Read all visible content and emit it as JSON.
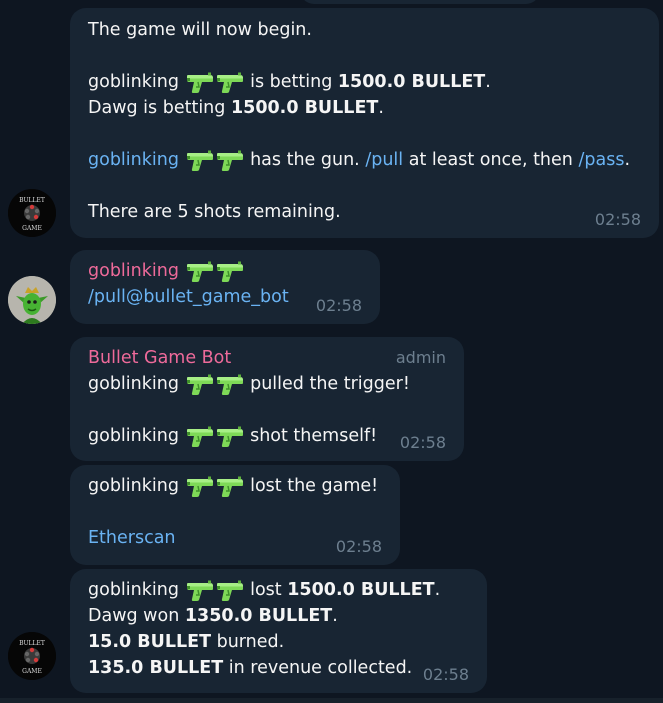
{
  "chat": {
    "m1": {
      "l1": "The game will now begin.",
      "l2_user": "goblinking",
      "l2_text": "is betting",
      "l2_amount": "1500.0 BULLET",
      "l2_end": ".",
      "l3_user": "Dawg is betting",
      "l3_amount": "1500.0 BULLET",
      "l3_end": ".",
      "l4_user": "goblinking",
      "l4_text1": "has the gun.",
      "l4_cmd1": "/pull",
      "l4_text2": "at least once, then",
      "l4_cmd2": "/pass",
      "l4_end": ".",
      "l5": "There are 5 shots remaining.",
      "time": "02:58"
    },
    "m2": {
      "sender": "goblinking",
      "command": "/pull@bullet_game_bot",
      "time": "02:58"
    },
    "m3": {
      "sender": "Bullet Game Bot",
      "role": "admin",
      "l1_user": "goblinking",
      "l1_text": "pulled the trigger!",
      "l2_user": "goblinking",
      "l2_text": "shot themself!",
      "time": "02:58"
    },
    "m4": {
      "l1_user": "goblinking",
      "l1_text": "lost the game!",
      "link": "Etherscan",
      "time": "02:58"
    },
    "m5": {
      "l1_user": "goblinking",
      "l1_text": "lost",
      "l1_amount": "1500.0 BULLET",
      "l1_end": ".",
      "l2_text": "Dawg won",
      "l2_amount": "1350.0 BULLET",
      "l2_end": ".",
      "l3_amount": "15.0 BULLET",
      "l3_text": "burned.",
      "l4_amount": "135.0 BULLET",
      "l4_text": "in revenue collected.",
      "time": "02:58"
    },
    "avatars": {
      "bot_logo_text_top": "BULLET",
      "bot_logo_text_bottom": "GAME"
    }
  },
  "colors": {
    "background": "#0e1621",
    "bubble": "#182533",
    "link": "#6ab3f3",
    "sender_name": "#ee6a9a",
    "timestamp": "#6d7f8f",
    "gun_icon": "#7ed957"
  }
}
